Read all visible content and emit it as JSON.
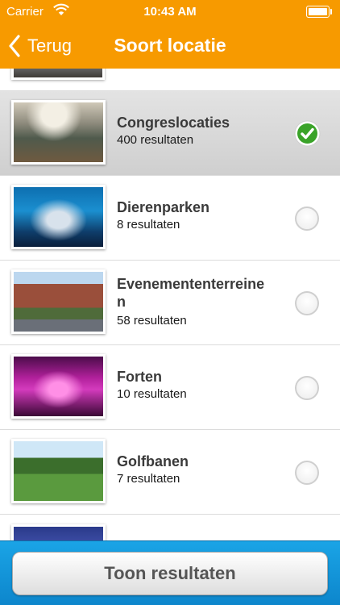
{
  "status_bar": {
    "carrier": "Carrier",
    "time": "10:43 AM"
  },
  "nav": {
    "back_label": "Terug",
    "title": "Soort locatie"
  },
  "colors": {
    "nav_background": "#f79a00",
    "footer_background": "#0d86cc",
    "check_green": "#3aa329"
  },
  "rows": [
    {
      "name": "Congreslocaties",
      "count": "400 resultaten",
      "selected": true
    },
    {
      "name": "Dierenparken",
      "count": "8 resultaten",
      "selected": false
    },
    {
      "name": "Evenemententerreine\nn",
      "count": "58 resultaten",
      "selected": false
    },
    {
      "name": "Forten",
      "count": "10 resultaten",
      "selected": false
    },
    {
      "name": "Golfbanen",
      "count": "7 resultaten",
      "selected": false
    }
  ],
  "footer": {
    "button_label": "Toon resultaten"
  }
}
